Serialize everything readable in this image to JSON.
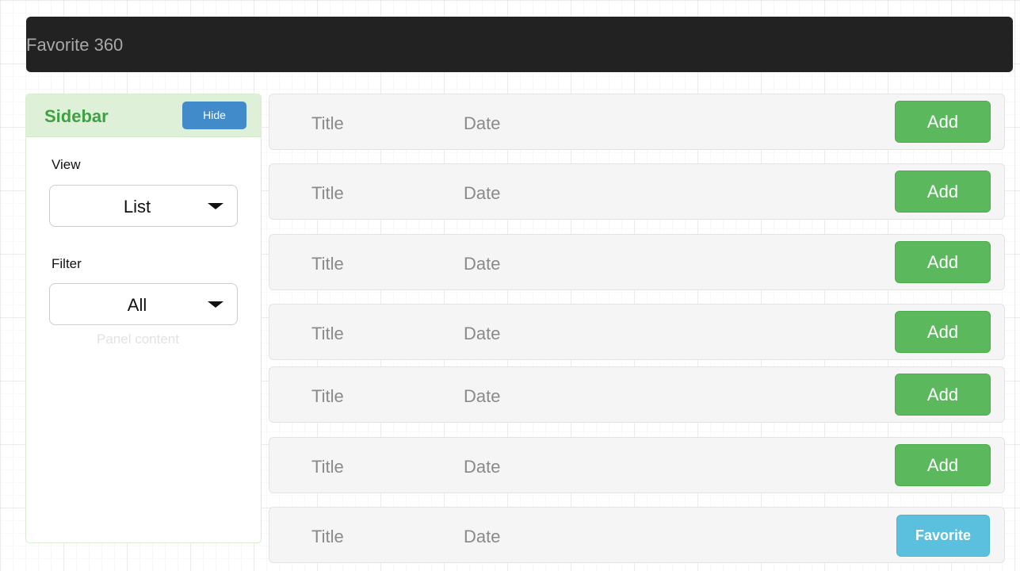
{
  "header": {
    "brand": "Favorite 360"
  },
  "sidebar": {
    "title": "Sidebar",
    "hide_label": "Hide",
    "view_label": "View",
    "view_value": "List",
    "filter_label": "Filter",
    "filter_value": "All",
    "panel_content": "Panel content"
  },
  "rows": [
    {
      "title": "Title",
      "date": "Date",
      "action": "Add"
    },
    {
      "title": "Title",
      "date": "Date",
      "action": "Add"
    },
    {
      "title": "Title",
      "date": "Date",
      "action": "Add"
    },
    {
      "title": "Title",
      "date": "Date",
      "action": "Add"
    },
    {
      "title": "Title",
      "date": "Date",
      "action": "Add"
    },
    {
      "title": "Title",
      "date": "Date",
      "action": "Add"
    },
    {
      "title": "Title",
      "date": "Date",
      "action": "Favorite"
    }
  ],
  "colors": {
    "navbar": "#222222",
    "sidebar_heading_bg": "#dff0d8",
    "sidebar_title": "#3f9f44",
    "hide_button": "#428bca",
    "add_button": "#5cb85c",
    "favorite_button": "#5bc0de"
  }
}
